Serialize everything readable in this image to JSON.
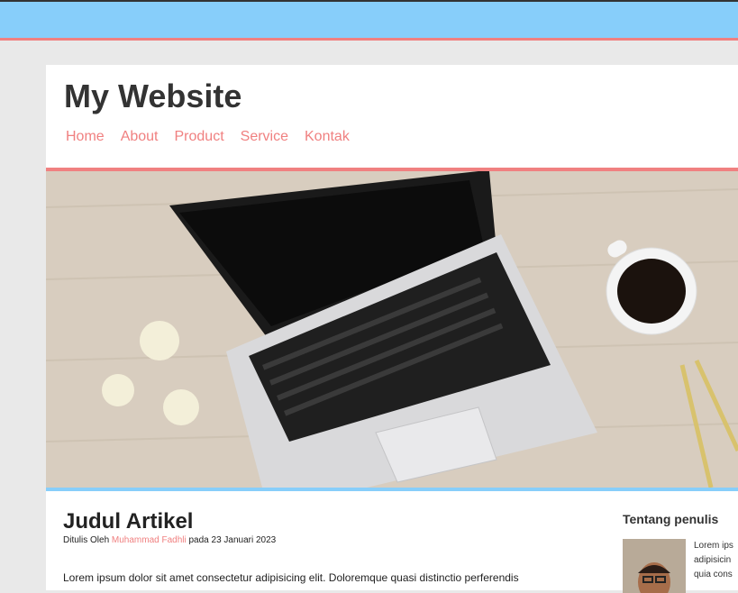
{
  "header": {
    "site_title": "My Website"
  },
  "nav": {
    "items": [
      "Home",
      "About",
      "Product",
      "Service",
      "Kontak"
    ]
  },
  "article": {
    "title": "Judul Artikel",
    "meta_prefix": "Ditulis Oleh ",
    "author": "Muhammad Fadhli",
    "meta_suffix": " pada 23 Januari 2023",
    "body": "Lorem ipsum dolor sit amet consectetur adipisicing elit. Doloremque quasi distinctio perferendis"
  },
  "sidebar": {
    "title": "Tentang penulis",
    "lines": [
      "Lorem ips",
      "adipisicin",
      "quia cons"
    ]
  },
  "colors": {
    "accent": "#f08080",
    "blue": "#87cefa"
  }
}
